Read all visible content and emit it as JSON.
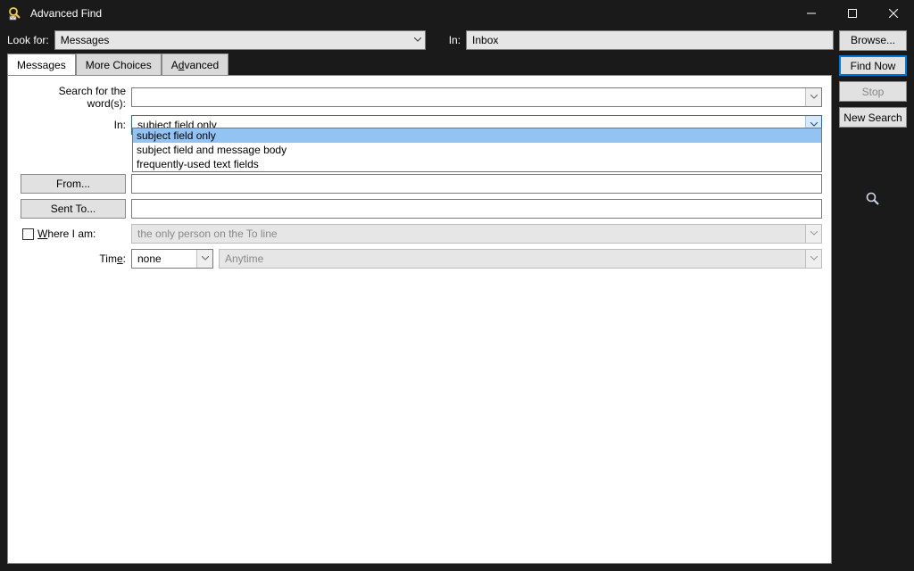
{
  "window": {
    "title": "Advanced Find"
  },
  "toprow": {
    "look_for_label": "Look for:",
    "look_for_value": "Messages",
    "in_label": "In:",
    "in_value": "Inbox",
    "browse_label": "Browse..."
  },
  "side": {
    "find_now": "Find Now",
    "stop": "Stop",
    "new_search": "New Search"
  },
  "tabs": {
    "messages": "Messages",
    "more_choices": "More Choices",
    "advanced": "Advanced"
  },
  "form": {
    "search_words_label": "Search for the word(s):",
    "in_label": "In:",
    "in_value": "subject field only",
    "from_btn": "From...",
    "sent_to_btn": "Sent To...",
    "where_label": "Where I am:",
    "where_value": "the only person on the To line",
    "time_label": "Time:",
    "time_value": "none",
    "time_range": "Anytime"
  },
  "dropdown": {
    "opt1": "subject field only",
    "opt2": "subject field and message body",
    "opt3": "frequently-used text fields"
  }
}
